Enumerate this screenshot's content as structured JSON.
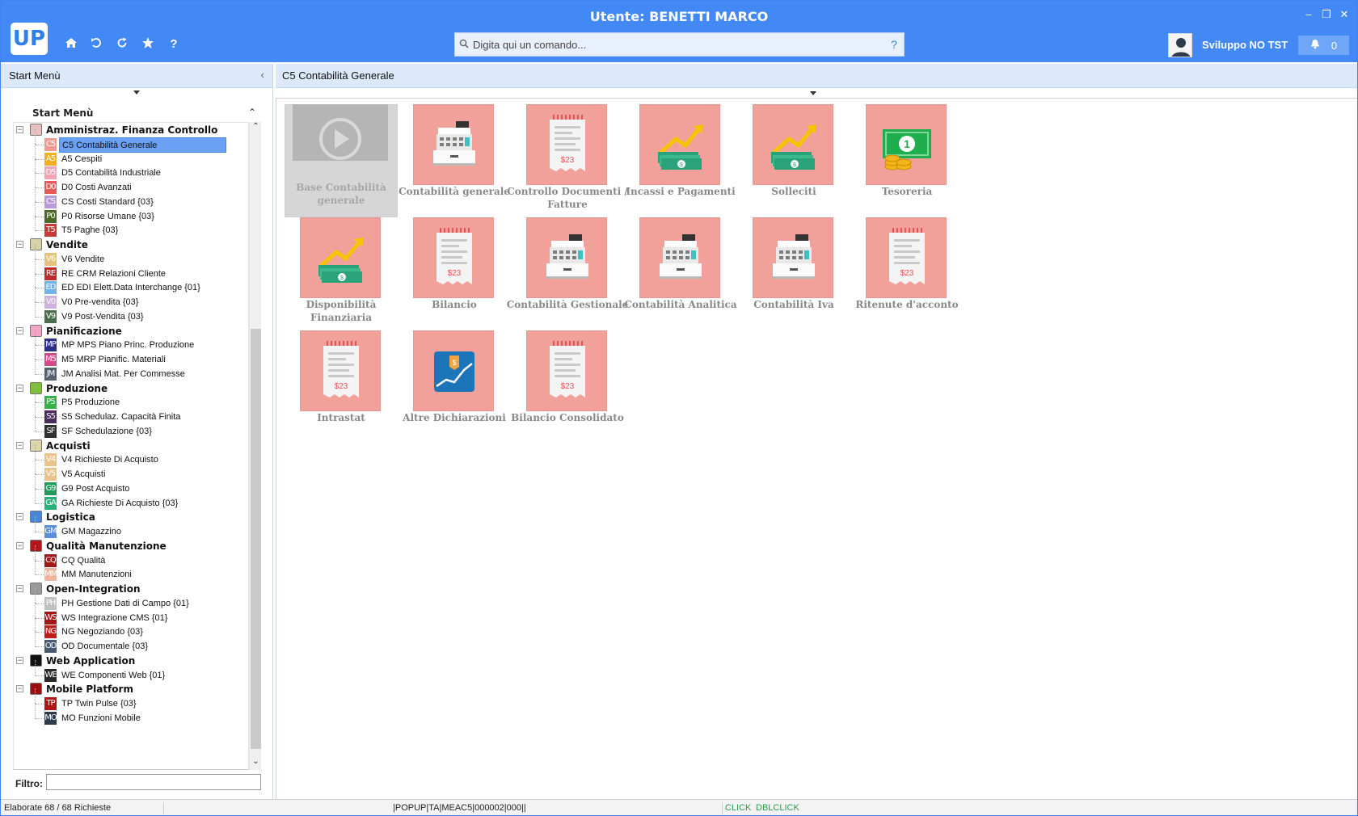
{
  "window": {
    "title": "Utente: BENETTI MARCO"
  },
  "toolbar": {
    "logo": "UP",
    "home_icon": "home-icon",
    "undo_icon": "undo-icon",
    "refresh_icon": "refresh-icon",
    "favorites_icon": "star-icon",
    "help_icon": "help-icon"
  },
  "search": {
    "placeholder": "Digita qui un comando...",
    "help": "?"
  },
  "user": {
    "environment": "Sviluppo NO TST",
    "notifications": "0"
  },
  "left_panel": {
    "title": "Start Menù",
    "tree_title": "Start Menù",
    "filter_label": "Filtro:",
    "filter_value": ""
  },
  "right_panel": {
    "title": "C5 Contabilità Generale"
  },
  "tree": [
    {
      "category": "Amministraz. Finanza Controllo",
      "color": "#e8c0c0",
      "items": [
        {
          "code": "C5",
          "color": "#f09a92",
          "label": "C5 Contabilità Generale"
        },
        {
          "code": "A5",
          "color": "#f0b020",
          "label": "A5 Cespiti"
        },
        {
          "code": "D5",
          "color": "#f0a4b4",
          "label": "D5 Contabilità Industriale"
        },
        {
          "code": "D0",
          "color": "#e65a5a",
          "label": "D0 Costi Avanzati"
        },
        {
          "code": "CS",
          "color": "#b79ad6",
          "label": "CS Costi Standard {03}"
        },
        {
          "code": "P0",
          "color": "#4e6a2a",
          "label": "P0 Risorse Umane {03}"
        },
        {
          "code": "T5",
          "color": "#c83a3a",
          "label": "T5 Paghe {03}"
        }
      ]
    },
    {
      "category": "Vendite",
      "color": "#d7d2a8",
      "items": [
        {
          "code": "V6",
          "color": "#e3c27a",
          "label": "V6 Vendite"
        },
        {
          "code": "RE",
          "color": "#c02a2a",
          "label": "RE CRM Relazioni Cliente"
        },
        {
          "code": "ED",
          "color": "#72b0e8",
          "label": "ED EDI Elett.Data Interchange {01}"
        },
        {
          "code": "V0",
          "color": "#cdb2dc",
          "label": "V0 Pre-vendita {03}"
        },
        {
          "code": "V9",
          "color": "#4d6e4d",
          "label": "V9 Post-Vendita {03}"
        }
      ]
    },
    {
      "category": "Pianificazione",
      "color": "#f2a6c6",
      "items": [
        {
          "code": "MP",
          "color": "#2b2f86",
          "label": "MP MPS Piano Princ. Produzione"
        },
        {
          "code": "M5",
          "color": "#d24a8a",
          "label": "M5 MRP Pianific. Materiali"
        },
        {
          "code": "JM",
          "color": "#55606e",
          "label": "JM Analisi Mat. Per Commesse"
        }
      ]
    },
    {
      "category": "Produzione",
      "color": "#7fbf3f",
      "items": [
        {
          "code": "P5",
          "color": "#36b04a",
          "label": "P5 Produzione"
        },
        {
          "code": "S5",
          "color": "#4a2d5e",
          "label": "S5 Schedulaz. Capacità Finita"
        },
        {
          "code": "SF",
          "color": "#303030",
          "label": "SF Schedulazione {03}"
        }
      ]
    },
    {
      "category": "Acquisti",
      "color": "#dcd6a8",
      "items": [
        {
          "code": "V4",
          "color": "#e8c48a",
          "label": "V4 Richieste Di Acquisto"
        },
        {
          "code": "V5",
          "color": "#e8c48a",
          "label": "V5 Acquisti"
        },
        {
          "code": "G9",
          "color": "#1f9a5a",
          "label": "G9 Post Acquisto"
        },
        {
          "code": "GA",
          "color": "#2ab07a",
          "label": "GA Richieste Di Acquisto {03}"
        }
      ]
    },
    {
      "category": "Logistica",
      "color": "#4a86d8",
      "items": [
        {
          "code": "GM",
          "color": "#5a8ed8",
          "label": "GM Magazzino"
        }
      ]
    },
    {
      "category": "Qualità Manutenzione",
      "color": "#b01818",
      "items": [
        {
          "code": "CQ",
          "color": "#a01818",
          "label": "CQ Qualità"
        },
        {
          "code": "MM",
          "color": "#f0b4a0",
          "label": "MM Manutenzioni"
        }
      ]
    },
    {
      "category": "Open-Integration",
      "color": "#9a9a9a",
      "items": [
        {
          "code": "PH",
          "color": "#c0c0c0",
          "label": "PH Gestione Dati di Campo {01}"
        },
        {
          "code": "WS",
          "color": "#a01818",
          "label": "WS Integrazione CMS {01}"
        },
        {
          "code": "NG",
          "color": "#c01c1c",
          "label": "NG Negoziando {03}"
        },
        {
          "code": "OD",
          "color": "#4a5a6e",
          "label": "OD Documentale {03}"
        }
      ]
    },
    {
      "category": "Web Application",
      "color": "#111111",
      "items": [
        {
          "code": "WE",
          "color": "#2a2a2a",
          "label": "WE Componenti Web {01}"
        }
      ]
    },
    {
      "category": "Mobile Platform",
      "color": "#9a1010",
      "items": [
        {
          "code": "TP",
          "color": "#b01414",
          "label": "TP Twin Pulse {03}"
        },
        {
          "code": "MO",
          "color": "#2c3a4c",
          "label": "MO Funzioni Mobile"
        }
      ]
    }
  ],
  "tiles": [
    {
      "label": "Base Contabilità generale",
      "icon": "play-icon",
      "disabled": true
    },
    {
      "label": "Contabilità generale",
      "icon": "cash-register-icon"
    },
    {
      "label": "Controllo Documenti / Fatture",
      "icon": "receipt-icon",
      "receipt_text": "$23"
    },
    {
      "label": "Incassi e Pagamenti",
      "icon": "money-growth-icon"
    },
    {
      "label": "Solleciti",
      "icon": "money-growth-icon"
    },
    {
      "label": "Tesoreria",
      "icon": "banknote-coins-icon"
    },
    {
      "label": "Disponibilità Finanziaria",
      "icon": "money-growth-icon"
    },
    {
      "label": "Bilancio",
      "icon": "receipt-icon",
      "receipt_text": "$23"
    },
    {
      "label": "Contabilità Gestionale",
      "icon": "cash-register-icon"
    },
    {
      "label": "Contabilità Analitica",
      "icon": "cash-register-icon"
    },
    {
      "label": "Contabilità Iva",
      "icon": "cash-register-icon"
    },
    {
      "label": "Ritenute d'acconto",
      "icon": "receipt-icon",
      "receipt_text": "$23"
    },
    {
      "label": "Intrastat",
      "icon": "receipt-icon",
      "receipt_text": "$23"
    },
    {
      "label": "Altre Dichiarazioni",
      "icon": "financial-chart-icon"
    },
    {
      "label": "Bilancio Consolidato",
      "icon": "receipt-icon",
      "receipt_text": "$23"
    }
  ],
  "status": {
    "left": "Elaborate 68 / 68 Richieste",
    "middle": "|POPUP|TA|MEAC5|000002|000||",
    "click": "CLICK",
    "dblclick": "DBLCLICK"
  }
}
